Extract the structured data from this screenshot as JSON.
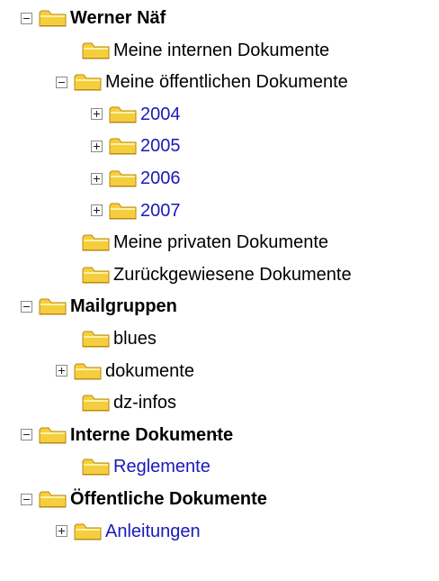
{
  "tree": {
    "items": [
      {
        "label": "Werner Näf",
        "level": 0,
        "toggle": "minus",
        "style": "bold"
      },
      {
        "label": "Meine internen Dokumente",
        "level": 2,
        "toggle": "none",
        "style": "normal"
      },
      {
        "label": "Meine öffentlichen Dokumente",
        "level": 1,
        "toggle": "minus",
        "style": "normal"
      },
      {
        "label": "2004",
        "level": 2,
        "toggle": "plus",
        "style": "link"
      },
      {
        "label": "2005",
        "level": 2,
        "toggle": "plus",
        "style": "link"
      },
      {
        "label": "2006",
        "level": 2,
        "toggle": "plus",
        "style": "link"
      },
      {
        "label": "2007",
        "level": 2,
        "toggle": "plus",
        "style": "link"
      },
      {
        "label": "Meine privaten Dokumente",
        "level": 1,
        "toggle": "none",
        "style": "normal"
      },
      {
        "label": "Zurückgewiesene Dokumente",
        "level": 1,
        "toggle": "none",
        "style": "normal"
      },
      {
        "label": "Mailgruppen",
        "level": 0,
        "toggle": "minus",
        "style": "bold"
      },
      {
        "label": "blues",
        "level": 1,
        "toggle": "none",
        "style": "normal"
      },
      {
        "label": "dokumente",
        "level": 1,
        "toggle": "plus",
        "style": "normal"
      },
      {
        "label": "dz-infos",
        "level": 1,
        "toggle": "none",
        "style": "normal"
      },
      {
        "label": "Interne Dokumente",
        "level": 0,
        "toggle": "minus",
        "style": "bold"
      },
      {
        "label": "Reglemente",
        "level": 1,
        "toggle": "none",
        "style": "link"
      },
      {
        "label": "Öffentliche Dokumente",
        "level": 0,
        "toggle": "minus",
        "style": "bold"
      },
      {
        "label": "Anleitungen",
        "level": 1,
        "toggle": "plus",
        "style": "link"
      }
    ]
  },
  "icons": {
    "folder": "folder-icon",
    "expand": "expand-icon",
    "collapse": "collapse-icon"
  },
  "colors": {
    "link": "#1a1ab8",
    "text": "#000000",
    "folder_fill": "#f6ce3d",
    "folder_light": "#fff2a6",
    "folder_border": "#b88a11"
  }
}
